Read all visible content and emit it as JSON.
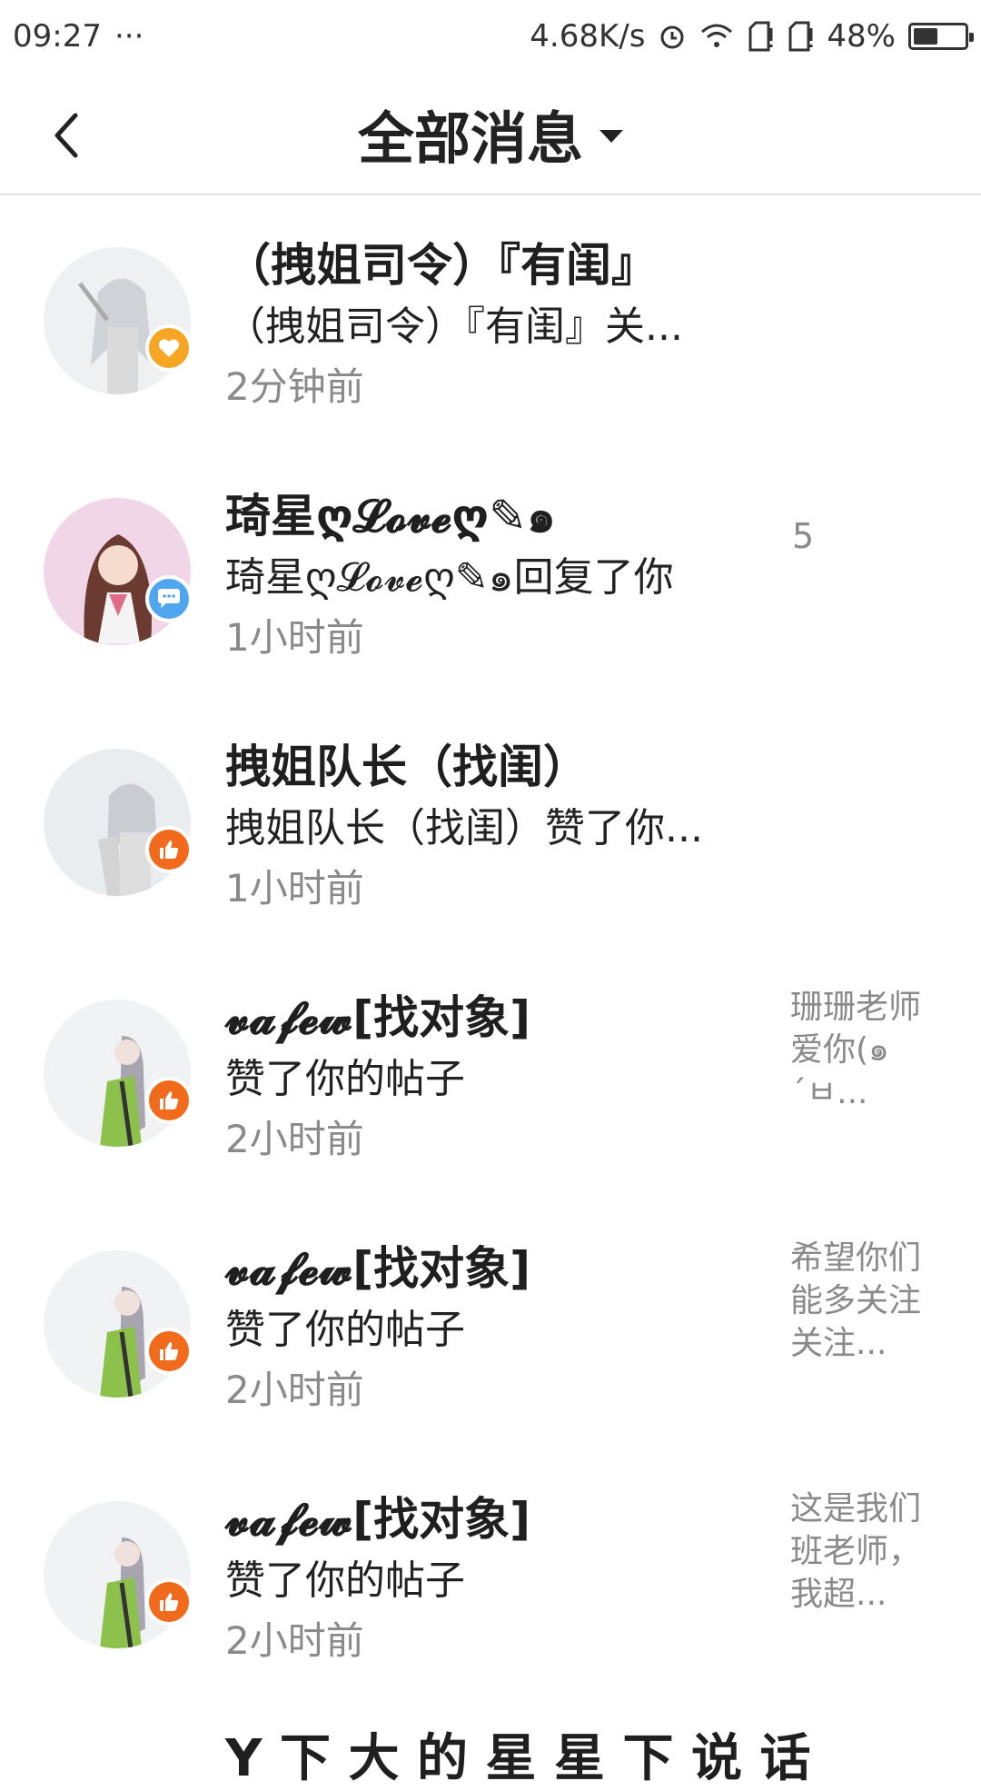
{
  "status_bar": {
    "time": "09:27",
    "dots": "···",
    "speed": "4.68K/s",
    "battery": "48%",
    "battery_level": 0.48
  },
  "header": {
    "title": "全部消息"
  },
  "messages": [
    {
      "name": "（拽姐司令）『有闺』",
      "snippet": "（拽姐司令）『有闺』关...",
      "time": "2分钟前",
      "badge": "heart-icon",
      "badge_color": "#f6a623",
      "side": "",
      "count": ""
    },
    {
      "name": "琦星ღ𝓛𝓸𝓿𝓮ღ✎๑",
      "snippet": "琦星ღ𝓛𝓸𝓿𝓮ღ✎๑回复了你",
      "time": "1小时前",
      "badge": "chat-bubble-icon",
      "badge_color": "#4fa6ee",
      "side": "",
      "count": "5"
    },
    {
      "name": "拽姐队长（找闺）",
      "snippet": "拽姐队长（找闺）赞了你...",
      "time": "1小时前",
      "badge": "thumbs-up-icon",
      "badge_color": "#f26b1d",
      "side": "",
      "count": ""
    },
    {
      "name": "𝓿𝓪𝓯𝓮𝔀[找对象]",
      "snippet": "赞了你的帖子",
      "time": "2小时前",
      "badge": "thumbs-up-icon",
      "badge_color": "#f26b1d",
      "side": "珊珊老师爱你(๑´ㅂ...",
      "count": ""
    },
    {
      "name": "𝓿𝓪𝓯𝓮𝔀[找对象]",
      "snippet": "赞了你的帖子",
      "time": "2小时前",
      "badge": "thumbs-up-icon",
      "badge_color": "#f26b1d",
      "side": "希望你们能多关注关注...",
      "count": ""
    },
    {
      "name": "𝓿𝓪𝓯𝓮𝔀[找对象]",
      "snippet": "赞了你的帖子",
      "time": "2小时前",
      "badge": "thumbs-up-icon",
      "badge_color": "#f26b1d",
      "side": "这是我们班老师，我超...",
      "count": ""
    }
  ],
  "partial_item": {
    "name": "Y 下 大 的 星 星 下 说 话"
  }
}
